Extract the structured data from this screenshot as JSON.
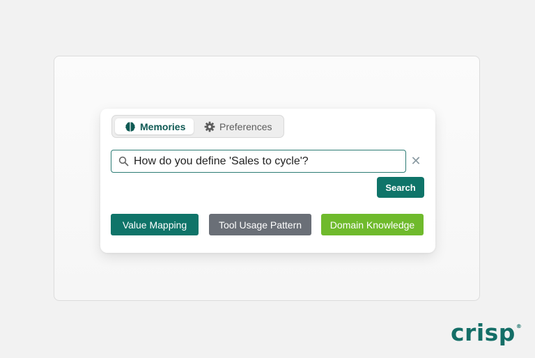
{
  "tabs": {
    "memories_label": "Memories",
    "preferences_label": "Preferences"
  },
  "search": {
    "value": "How do you define 'Sales to cycle'?",
    "clear_symbol": "✕",
    "button_label": "Search"
  },
  "tags": [
    {
      "label": "Value Mapping",
      "color": "#0f7469"
    },
    {
      "label": "Tool Usage Pattern",
      "color": "#6a6f77"
    },
    {
      "label": "Domain Knowledge",
      "color": "#6fba2c"
    }
  ],
  "brand": {
    "name": "crisp",
    "mark": "®",
    "color": "#146e67"
  },
  "icons": {
    "memories_tab": "brain-icon",
    "preferences_tab": "gear-icon",
    "search_field": "search-icon",
    "clear": "close-icon"
  }
}
